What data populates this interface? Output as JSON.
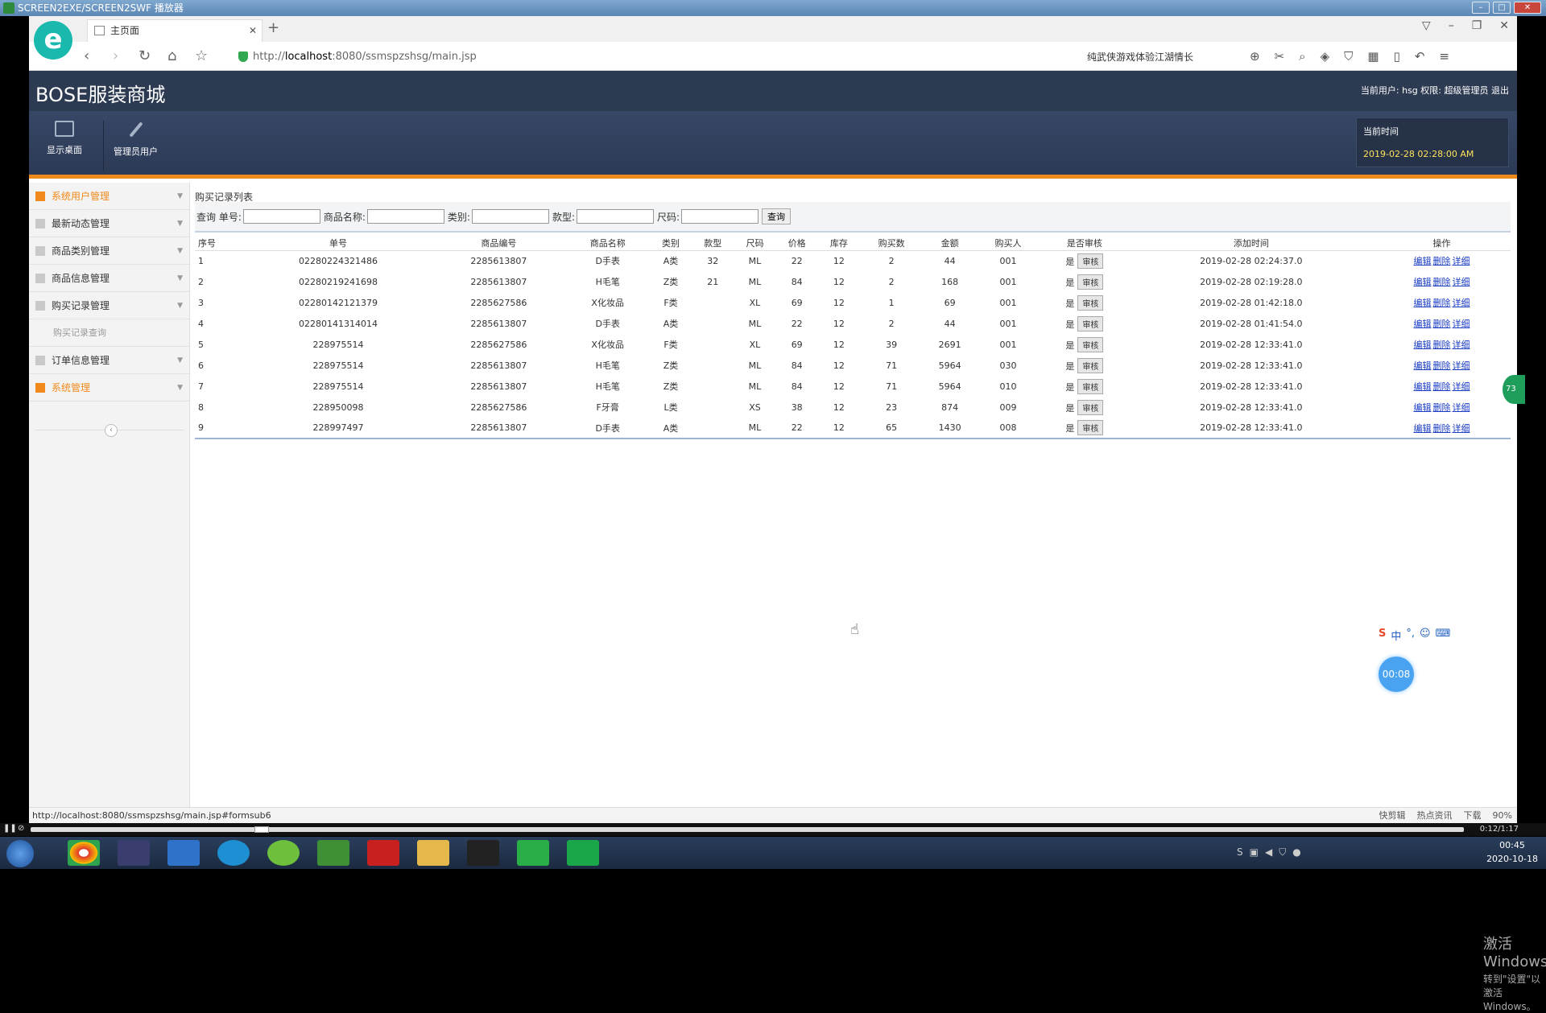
{
  "player": {
    "title": "SCREEN2EXE/SCREEN2SWF 播放器",
    "position": "0:12/1:17"
  },
  "browser": {
    "tab_title": "主页面",
    "new_tab": "+",
    "url_prefix": "http://",
    "url_host": "localhost",
    "url_rest": ":8080/ssmspzshsg/main.jsp",
    "hot_search": "纯武侠游戏体验江湖情长",
    "status_url": "http://localhost:8080/ssmspzshsg/main.jsp#formsub6",
    "status_items": [
      "快剪辑",
      "热点资讯",
      "下载",
      "90%"
    ]
  },
  "app": {
    "title": "BOSE服装商城",
    "user_info": "当前用户: hsg  权限: 超级管理员  退出",
    "tools": [
      {
        "label": "显示桌面",
        "icon": "monitor-icon"
      },
      {
        "label": "管理员用户",
        "icon": "pencil-icon"
      }
    ],
    "clock_label": "当前时间",
    "clock_value": "2019-02-28 02:28:00 AM"
  },
  "sidebar": {
    "items": [
      {
        "label": "系统用户管理",
        "active": true
      },
      {
        "label": "最新动态管理",
        "active": false
      },
      {
        "label": "商品类别管理",
        "active": false
      },
      {
        "label": "商品信息管理",
        "active": false
      },
      {
        "label": "购买记录管理",
        "active": false
      },
      {
        "label": "订单信息管理",
        "active": false
      },
      {
        "label": "系统管理",
        "active": true
      }
    ],
    "sub_item": "购买记录查询"
  },
  "content": {
    "list_title": "购买记录列表",
    "query": {
      "q_label": "查询 单号:",
      "name_label": "商品名称:",
      "type_label": "类别:",
      "model_label": "款型:",
      "size_label": "尺码:",
      "button": "查询"
    },
    "columns": [
      "序号",
      "单号",
      "商品编号",
      "商品名称",
      "类别",
      "款型",
      "尺码",
      "价格",
      "库存",
      "购买数",
      "金额",
      "购买人",
      "是否审核",
      "添加时间",
      "操作"
    ],
    "rows": [
      [
        "1",
        "02280224321486",
        "2285613807",
        "D手表",
        "A类",
        "32",
        "ML",
        "22",
        "12",
        "2",
        "44",
        "001",
        "是",
        "2019-02-28 02:24:37.0"
      ],
      [
        "2",
        "02280219241698",
        "2285613807",
        "H毛笔",
        "Z类",
        "21",
        "ML",
        "84",
        "12",
        "2",
        "168",
        "001",
        "是",
        "2019-02-28 02:19:28.0"
      ],
      [
        "3",
        "02280142121379",
        "2285627586",
        "X化妆品",
        "F类",
        "",
        "XL",
        "69",
        "12",
        "1",
        "69",
        "001",
        "是",
        "2019-02-28 01:42:18.0"
      ],
      [
        "4",
        "02280141314014",
        "2285613807",
        "D手表",
        "A类",
        "",
        "ML",
        "22",
        "12",
        "2",
        "44",
        "001",
        "是",
        "2019-02-28 01:41:54.0"
      ],
      [
        "5",
        "228975514",
        "2285627586",
        "X化妆品",
        "F类",
        "",
        "XL",
        "69",
        "12",
        "39",
        "2691",
        "001",
        "是",
        "2019-02-28 12:33:41.0"
      ],
      [
        "6",
        "228975514",
        "2285613807",
        "H毛笔",
        "Z类",
        "",
        "ML",
        "84",
        "12",
        "71",
        "5964",
        "030",
        "是",
        "2019-02-28 12:33:41.0"
      ],
      [
        "7",
        "228975514",
        "2285613807",
        "H毛笔",
        "Z类",
        "",
        "ML",
        "84",
        "12",
        "71",
        "5964",
        "010",
        "是",
        "2019-02-28 12:33:41.0"
      ],
      [
        "8",
        "228950098",
        "2285627586",
        "F牙膏",
        "L类",
        "",
        "XS",
        "38",
        "12",
        "23",
        "874",
        "009",
        "是",
        "2019-02-28 12:33:41.0"
      ],
      [
        "9",
        "228997497",
        "2285613807",
        "D手表",
        "A类",
        "",
        "ML",
        "22",
        "12",
        "65",
        "1430",
        "008",
        "是",
        "2019-02-28 12:33:41.0"
      ]
    ],
    "audit_button": "审核",
    "ops": [
      "编辑",
      "删除",
      "详细"
    ]
  },
  "overlay": {
    "activate_title": "激活 Windows",
    "activate_sub": "转到\"设置\"以激活 Windows。",
    "timer": "00:08",
    "green_badge": "73",
    "ime": [
      "中",
      "°,",
      "☺",
      "⌨"
    ]
  },
  "taskbar": {
    "time": "00:45",
    "date": "2020-10-18"
  },
  "colors": {
    "header_bg": "#2c3a52",
    "accent": "#f08a1c",
    "link": "#1a3cc4"
  }
}
